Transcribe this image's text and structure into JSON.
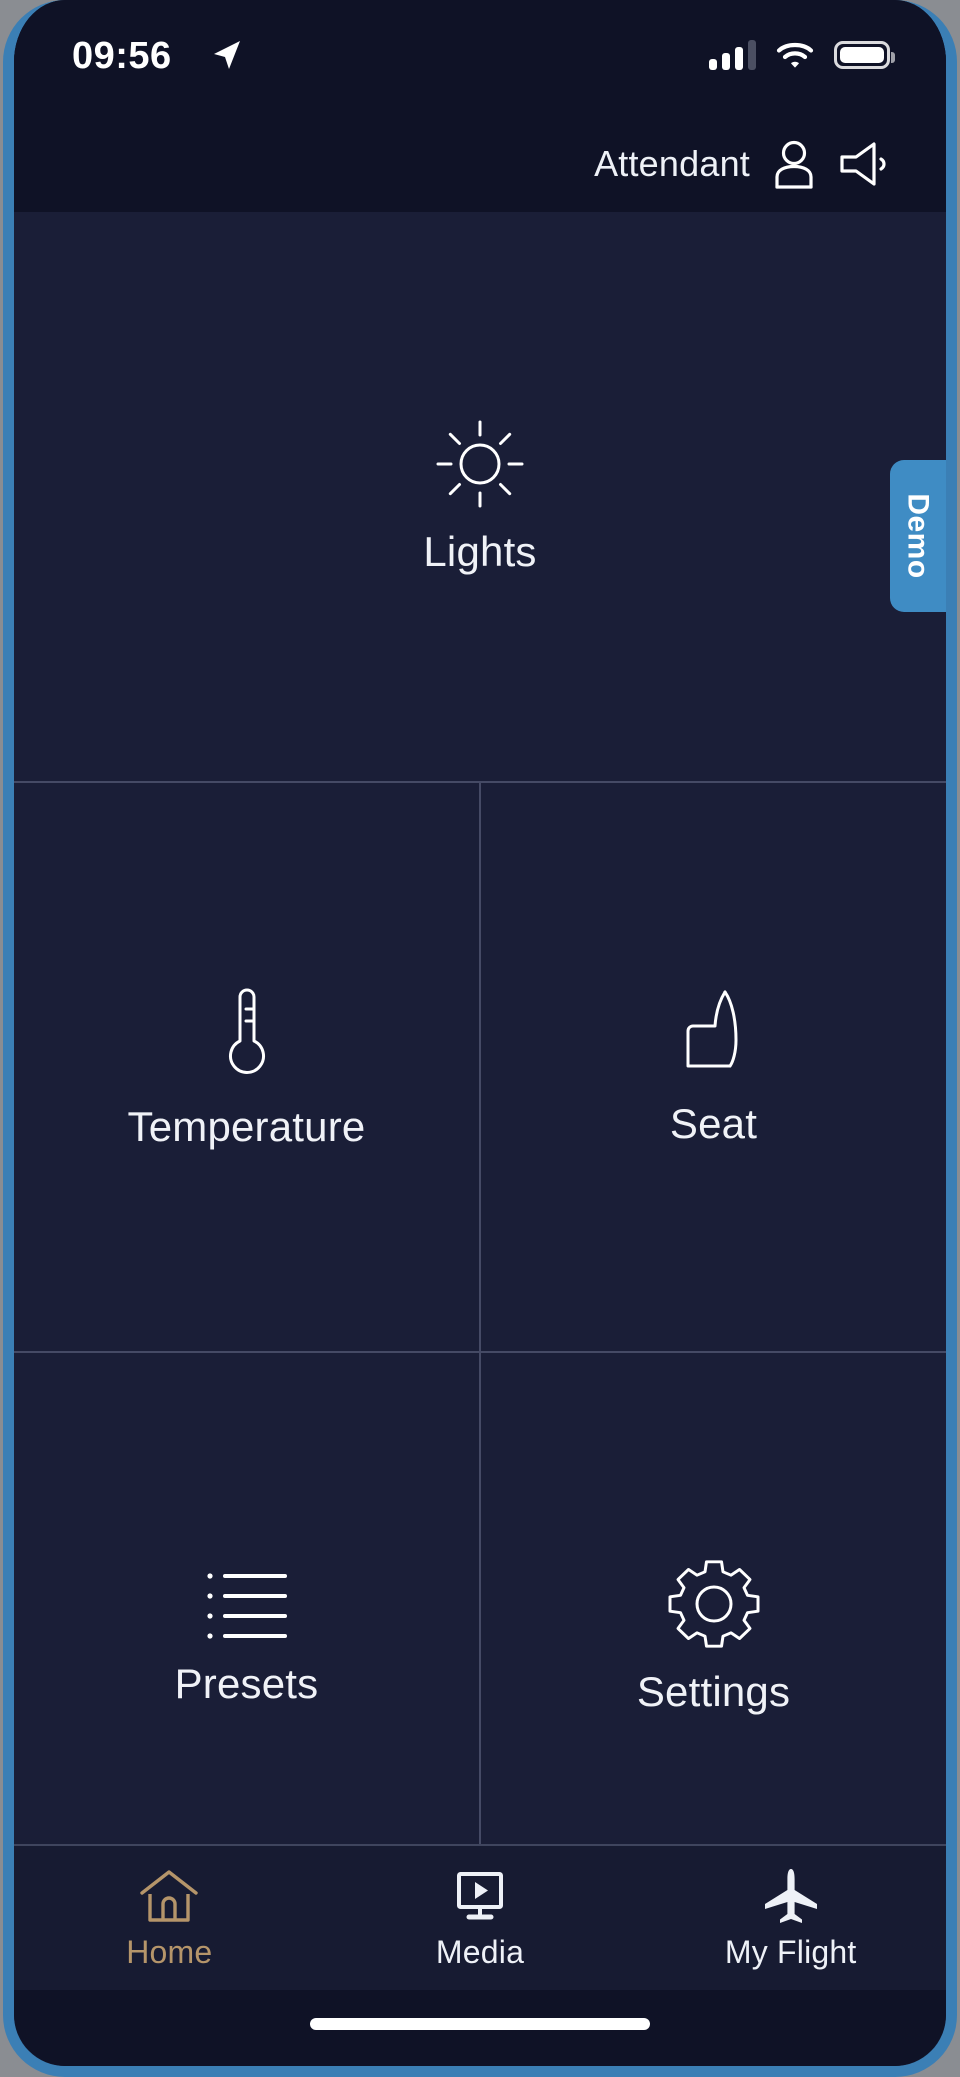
{
  "status_bar": {
    "time": "09:56",
    "location_icon": "location-arrow-icon",
    "signal_icon": "cellular-signal-icon",
    "wifi_icon": "wifi-icon",
    "battery_icon": "battery-icon"
  },
  "header": {
    "title": "Attendant",
    "person_icon": "person-icon",
    "speaker_icon": "speaker-icon"
  },
  "side_tab": {
    "label": "Demo",
    "color": "#3f8cc4"
  },
  "grid": {
    "tiles": [
      {
        "label": "Lights",
        "icon": "sun-icon",
        "span": "full"
      },
      {
        "label": "Temperature",
        "icon": "thermometer-icon",
        "span": "half"
      },
      {
        "label": "Seat",
        "icon": "seat-icon",
        "span": "half"
      },
      {
        "label": "Presets",
        "icon": "list-icon",
        "span": "half"
      },
      {
        "label": "Settings",
        "icon": "gear-icon",
        "span": "half"
      }
    ]
  },
  "bottom_nav": {
    "active_color": "#b5956a",
    "inactive_color": "#eef1f7",
    "items": [
      {
        "label": "Home",
        "icon": "home-icon",
        "active": true
      },
      {
        "label": "Media",
        "icon": "media-icon",
        "active": false
      },
      {
        "label": "My Flight",
        "icon": "airplane-icon",
        "active": false
      }
    ]
  },
  "colors": {
    "frame_border": "#3b7fb5",
    "status_bg": "#0f1226",
    "screen_bg": "#1a1e37",
    "divider": "rgba(168,180,210,0.30)",
    "text": "#f0f2f7"
  }
}
